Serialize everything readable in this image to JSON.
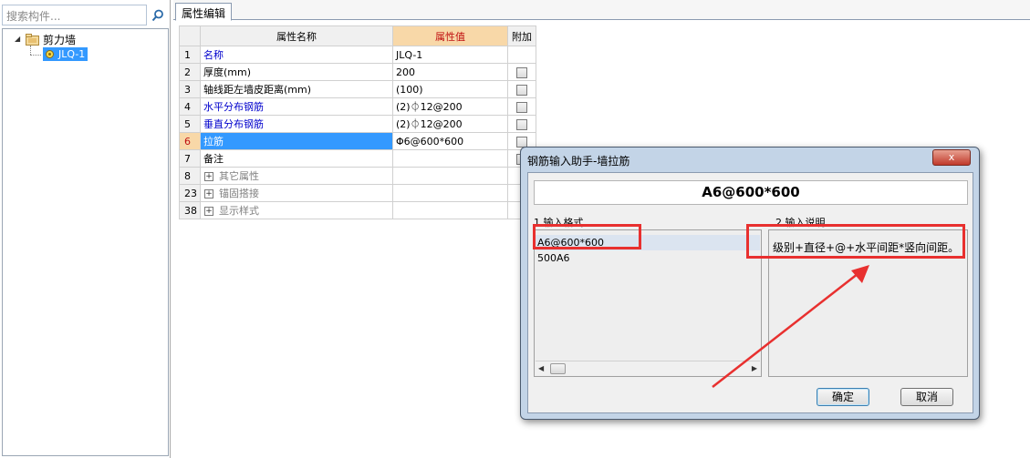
{
  "left": {
    "search_placeholder": "搜索构件...",
    "tree": {
      "root_label": "剪力墙",
      "child_label": "JLQ-1"
    }
  },
  "tabs": [
    {
      "label": "属性编辑"
    }
  ],
  "grid": {
    "headers": {
      "name": "属性名称",
      "value": "属性值",
      "extra": "附加"
    },
    "rows": [
      {
        "num": "1",
        "name": "名称",
        "value": "JLQ-1"
      },
      {
        "num": "2",
        "name": "厚度(mm)",
        "value": "200"
      },
      {
        "num": "3",
        "name": "轴线距左墙皮距离(mm)",
        "value": "(100)"
      },
      {
        "num": "4",
        "name": "水平分布钢筋",
        "value": "(2)⏀12@200"
      },
      {
        "num": "5",
        "name": "垂直分布钢筋",
        "value": "(2)⏀12@200"
      },
      {
        "num": "6",
        "name": "拉筋",
        "value": "Φ6@600*600"
      },
      {
        "num": "7",
        "name": "备注",
        "value": ""
      },
      {
        "num": "8",
        "name": "其它属性",
        "value": ""
      },
      {
        "num": "23",
        "name": "锚固搭接",
        "value": ""
      },
      {
        "num": "38",
        "name": "显示样式",
        "value": ""
      }
    ]
  },
  "dialog": {
    "title": "钢筋输入助手-墙拉筋",
    "close_label": "x",
    "preview": "A6@600*600",
    "format_label": "1.输入格式",
    "desc_label": "2.输入说明",
    "formats": [
      "A6@600*600",
      "500A6"
    ],
    "description": "级别+直径+@+水平间距*竖向间距。",
    "ok_label": "确定",
    "cancel_label": "取消"
  },
  "colors": {
    "selection": "#3399ff",
    "value_header_bg": "#f8d8a8",
    "annotation": "#e8302f"
  }
}
